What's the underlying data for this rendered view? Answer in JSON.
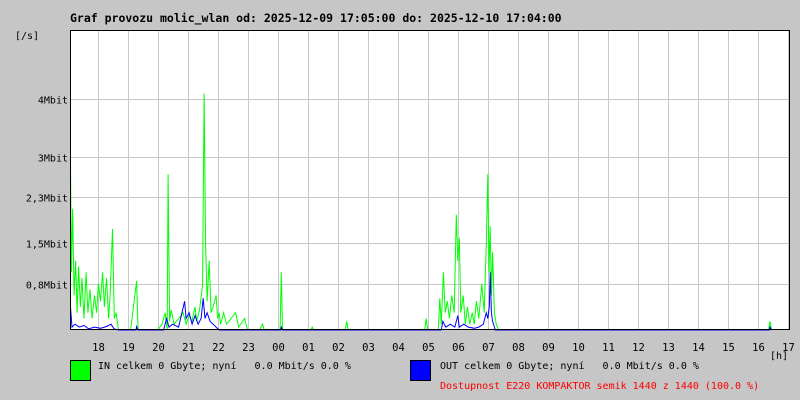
{
  "title": "Graf provozu molic_wlan od: 2025-12-09 17:05:00 do: 2025-12-10 17:04:00",
  "units": {
    "y": "[/s]",
    "x": "[h]"
  },
  "legend": {
    "in": {
      "text": "IN celkem 0 Gbyte; nyní   0.0 Mbit/s 0.0 %",
      "color": "#00ff00"
    },
    "out": {
      "text": "OUT celkem 0 Gbyte; nyní   0.0 Mbit/s 0.0 %",
      "color": "#0000ff"
    }
  },
  "availability": {
    "text": "Dostupnost E220 KOMPAKTOR semik 1440 z 1440 (100.0 %)",
    "color": "#ff0000"
  },
  "chart_data": {
    "type": "area",
    "ylim": [
      0,
      5.2
    ],
    "y_ticks": [
      {
        "value": 0.8,
        "label": "0,8Mbit"
      },
      {
        "value": 1.5,
        "label": "1,5Mbit"
      },
      {
        "value": 2.3,
        "label": "2,3Mbit"
      },
      {
        "value": 3.0,
        "label": "3Mbit"
      },
      {
        "value": 4.0,
        "label": "4Mbit"
      }
    ],
    "xlim": [
      17.083,
      41.067
    ],
    "x_ticks": [
      {
        "value": 18,
        "label": "18"
      },
      {
        "value": 19,
        "label": "19"
      },
      {
        "value": 20,
        "label": "20"
      },
      {
        "value": 21,
        "label": "21"
      },
      {
        "value": 22,
        "label": "22"
      },
      {
        "value": 23,
        "label": "23"
      },
      {
        "value": 24,
        "label": "00"
      },
      {
        "value": 25,
        "label": "01"
      },
      {
        "value": 26,
        "label": "02"
      },
      {
        "value": 27,
        "label": "03"
      },
      {
        "value": 28,
        "label": "04"
      },
      {
        "value": 29,
        "label": "05"
      },
      {
        "value": 30,
        "label": "06"
      },
      {
        "value": 31,
        "label": "07"
      },
      {
        "value": 32,
        "label": "08"
      },
      {
        "value": 33,
        "label": "09"
      },
      {
        "value": 34,
        "label": "10"
      },
      {
        "value": 35,
        "label": "11"
      },
      {
        "value": 36,
        "label": "12"
      },
      {
        "value": 37,
        "label": "13"
      },
      {
        "value": 38,
        "label": "14"
      },
      {
        "value": 39,
        "label": "15"
      },
      {
        "value": 40,
        "label": "16"
      },
      {
        "value": 41,
        "label": "17"
      }
    ],
    "grid": true,
    "series": [
      {
        "name": "IN",
        "color": "#00ff00",
        "points": [
          [
            17.1,
            2.9
          ],
          [
            17.13,
            1.0
          ],
          [
            17.17,
            2.1
          ],
          [
            17.22,
            0.6
          ],
          [
            17.27,
            1.2
          ],
          [
            17.32,
            0.3
          ],
          [
            17.37,
            1.1
          ],
          [
            17.43,
            0.4
          ],
          [
            17.48,
            0.9
          ],
          [
            17.55,
            0.2
          ],
          [
            17.62,
            1.0
          ],
          [
            17.68,
            0.3
          ],
          [
            17.75,
            0.7
          ],
          [
            17.82,
            0.2
          ],
          [
            17.9,
            0.6
          ],
          [
            17.97,
            0.3
          ],
          [
            18.03,
            0.8
          ],
          [
            18.1,
            0.5
          ],
          [
            18.17,
            1.0
          ],
          [
            18.23,
            0.4
          ],
          [
            18.3,
            0.9
          ],
          [
            18.37,
            0.2
          ],
          [
            18.42,
            0.6
          ],
          [
            18.5,
            1.75
          ],
          [
            18.56,
            0.2
          ],
          [
            18.62,
            0.3
          ],
          [
            18.7,
            0.0
          ],
          [
            19.1,
            0.0
          ],
          [
            19.3,
            0.85
          ],
          [
            19.35,
            0.0
          ],
          [
            20.0,
            0.0
          ],
          [
            20.15,
            0.1
          ],
          [
            20.25,
            0.3
          ],
          [
            20.32,
            0.0
          ],
          [
            20.35,
            2.7
          ],
          [
            20.4,
            0.15
          ],
          [
            20.45,
            0.35
          ],
          [
            20.55,
            0.1
          ],
          [
            20.7,
            0.2
          ],
          [
            20.85,
            0.3
          ],
          [
            20.95,
            0.1
          ],
          [
            21.05,
            0.25
          ],
          [
            21.15,
            0.15
          ],
          [
            21.2,
            0.3
          ],
          [
            21.25,
            0.4
          ],
          [
            21.3,
            0.15
          ],
          [
            21.4,
            0.35
          ],
          [
            21.5,
            0.8
          ],
          [
            21.55,
            4.1
          ],
          [
            21.6,
            1.5
          ],
          [
            21.65,
            0.5
          ],
          [
            21.72,
            1.2
          ],
          [
            21.78,
            0.3
          ],
          [
            21.85,
            0.4
          ],
          [
            21.95,
            0.6
          ],
          [
            22.0,
            0.2
          ],
          [
            22.05,
            0.3
          ],
          [
            22.1,
            0.1
          ],
          [
            22.2,
            0.3
          ],
          [
            22.3,
            0.1
          ],
          [
            22.45,
            0.2
          ],
          [
            22.6,
            0.3
          ],
          [
            22.7,
            0.05
          ],
          [
            22.9,
            0.2
          ],
          [
            23.0,
            0.0
          ],
          [
            23.4,
            0.0
          ],
          [
            23.5,
            0.1
          ],
          [
            23.55,
            0.0
          ],
          [
            24.08,
            0.0
          ],
          [
            24.12,
            1.0
          ],
          [
            24.16,
            0.0
          ],
          [
            25.1,
            0.0
          ],
          [
            25.15,
            0.05
          ],
          [
            25.2,
            0.0
          ],
          [
            26.25,
            0.0
          ],
          [
            26.3,
            0.15
          ],
          [
            26.35,
            0.0
          ],
          [
            28.9,
            0.0
          ],
          [
            28.95,
            0.2
          ],
          [
            29.0,
            0.0
          ],
          [
            29.35,
            0.0
          ],
          [
            29.4,
            0.55
          ],
          [
            29.45,
            0.1
          ],
          [
            29.52,
            1.0
          ],
          [
            29.58,
            0.3
          ],
          [
            29.65,
            0.5
          ],
          [
            29.72,
            0.2
          ],
          [
            29.8,
            0.6
          ],
          [
            29.88,
            0.3
          ],
          [
            29.95,
            2.0
          ],
          [
            30.0,
            1.2
          ],
          [
            30.05,
            1.6
          ],
          [
            30.1,
            0.3
          ],
          [
            30.18,
            0.6
          ],
          [
            30.25,
            0.1
          ],
          [
            30.32,
            0.4
          ],
          [
            30.4,
            0.1
          ],
          [
            30.48,
            0.3
          ],
          [
            30.55,
            0.1
          ],
          [
            30.62,
            0.5
          ],
          [
            30.7,
            0.2
          ],
          [
            30.8,
            0.8
          ],
          [
            30.88,
            0.3
          ],
          [
            30.95,
            1.5
          ],
          [
            31.0,
            2.7
          ],
          [
            31.04,
            1.0
          ],
          [
            31.08,
            1.8
          ],
          [
            31.12,
            0.6
          ],
          [
            31.16,
            1.35
          ],
          [
            31.22,
            0.3
          ],
          [
            31.28,
            0.1
          ],
          [
            31.35,
            0.0
          ],
          [
            40.35,
            0.0
          ],
          [
            40.4,
            0.15
          ],
          [
            40.45,
            0.0
          ]
        ]
      },
      {
        "name": "OUT",
        "color": "#0000ff",
        "points": [
          [
            17.1,
            0.4
          ],
          [
            17.15,
            0.05
          ],
          [
            17.25,
            0.1
          ],
          [
            17.4,
            0.05
          ],
          [
            17.55,
            0.08
          ],
          [
            17.7,
            0.02
          ],
          [
            17.9,
            0.05
          ],
          [
            18.1,
            0.03
          ],
          [
            18.3,
            0.06
          ],
          [
            18.45,
            0.1
          ],
          [
            18.55,
            0.02
          ],
          [
            18.7,
            0.0
          ],
          [
            19.28,
            0.0
          ],
          [
            19.3,
            0.06
          ],
          [
            19.35,
            0.0
          ],
          [
            20.2,
            0.0
          ],
          [
            20.3,
            0.2
          ],
          [
            20.38,
            0.05
          ],
          [
            20.5,
            0.1
          ],
          [
            20.7,
            0.05
          ],
          [
            20.9,
            0.5
          ],
          [
            20.95,
            0.2
          ],
          [
            21.05,
            0.3
          ],
          [
            21.15,
            0.1
          ],
          [
            21.25,
            0.25
          ],
          [
            21.35,
            0.1
          ],
          [
            21.45,
            0.2
          ],
          [
            21.52,
            0.55
          ],
          [
            21.58,
            0.2
          ],
          [
            21.65,
            0.3
          ],
          [
            21.75,
            0.15
          ],
          [
            21.85,
            0.1
          ],
          [
            21.95,
            0.05
          ],
          [
            22.05,
            0.0
          ],
          [
            24.1,
            0.0
          ],
          [
            24.12,
            0.05
          ],
          [
            24.16,
            0.0
          ],
          [
            29.45,
            0.0
          ],
          [
            29.5,
            0.15
          ],
          [
            29.6,
            0.05
          ],
          [
            29.75,
            0.1
          ],
          [
            29.9,
            0.05
          ],
          [
            30.0,
            0.25
          ],
          [
            30.05,
            0.05
          ],
          [
            30.2,
            0.1
          ],
          [
            30.35,
            0.05
          ],
          [
            30.55,
            0.03
          ],
          [
            30.7,
            0.05
          ],
          [
            30.85,
            0.1
          ],
          [
            30.95,
            0.3
          ],
          [
            31.0,
            0.2
          ],
          [
            31.05,
            0.4
          ],
          [
            31.08,
            1.0
          ],
          [
            31.12,
            0.3
          ],
          [
            31.16,
            0.15
          ],
          [
            31.25,
            0.0
          ],
          [
            40.38,
            0.0
          ],
          [
            40.4,
            0.05
          ],
          [
            40.45,
            0.0
          ]
        ]
      }
    ]
  }
}
